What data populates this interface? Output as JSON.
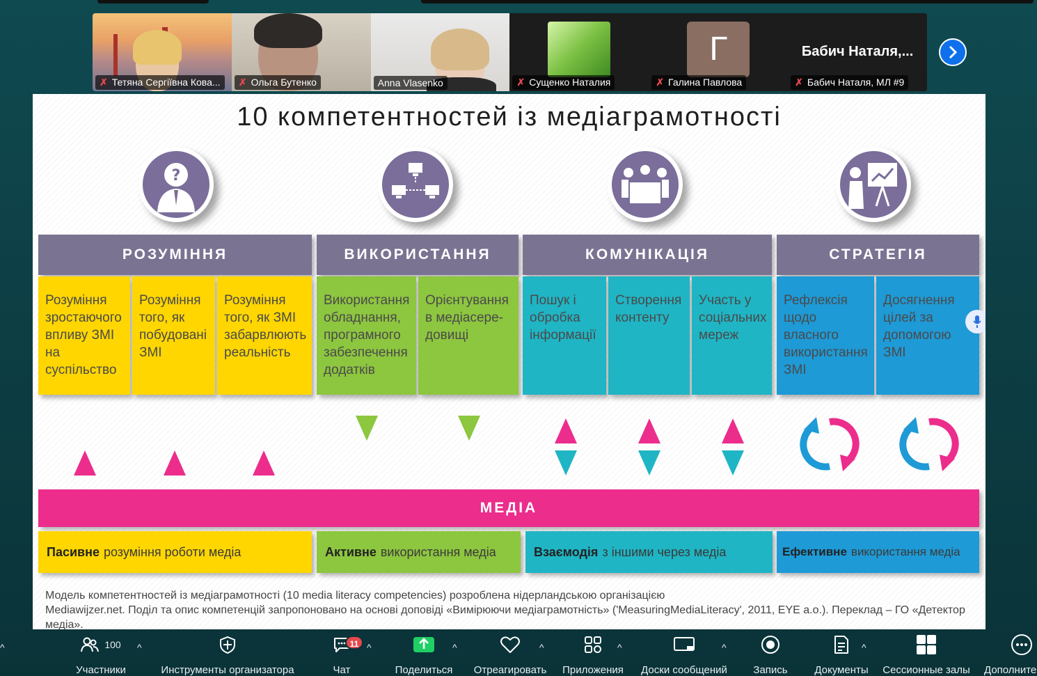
{
  "participants": [
    {
      "name": "Тетяна Сергіївна Кова...",
      "muted": true
    },
    {
      "name": "Ольга Бутенко",
      "muted": true
    },
    {
      "name": "Anna Vlasenko",
      "muted": false,
      "active": true
    },
    {
      "name": "Сущенко Наталия",
      "muted": true
    },
    {
      "name": "Галина Павлова",
      "muted": true,
      "initial": "Г"
    },
    {
      "name": "Бабич Наталя, МЛ #9",
      "muted": true,
      "big_name": "Бабич  Наталя,..."
    }
  ],
  "slide": {
    "title": "10 компетентностей із медіаграмотності",
    "categories": [
      {
        "label": "РОЗУМІННЯ",
        "icon": "question-person-icon"
      },
      {
        "label": "ВИКОРИСТАННЯ",
        "icon": "network-computers-icon"
      },
      {
        "label": "КОМУНІКАЦІЯ",
        "icon": "meeting-table-icon"
      },
      {
        "label": "СТРАТЕГІЯ",
        "icon": "presentation-board-icon"
      }
    ],
    "competences": [
      "Розуміння зростаючого впливу ЗМІ на суспільство",
      "Розуміння того, як побудовані ЗМІ",
      "Розуміння того, як ЗМІ забарвлюють реальність",
      "Використання обладнання, програмного забезпечення додатків",
      "Орієнтування в медіасере-довищі",
      "Пошук і обробка інформації",
      "Створення контенту",
      "Участь у соціальних мереж",
      "Рефлексія щодо власного використання ЗМІ",
      "Досягнення цілей за допомогою ЗМІ"
    ],
    "media_label": "МЕДІА",
    "bottom": [
      {
        "bold": "Пасивне",
        "rest": "розуміння роботи медіа"
      },
      {
        "bold": "Активне",
        "rest": "використання медіа"
      },
      {
        "bold": "Взаємодія",
        "rest": "з іншими через медіа"
      },
      {
        "bold": "Ефективне",
        "rest": "використання медіа"
      }
    ],
    "footnote_line1": "Модель компетентностей із медіаграмотності (10 media  literacy competencies) розроблена  нідерландською  організацією",
    "footnote_line2": "Mediawijzer.net. Поділ та опис компетенцій запропоновано на основі доповіді «Вимірюючи медіаграмотність» ('MeasuringMediaLiteracy', 2011, EYE a.o.). Переклад – ГО «Детектор медіа»."
  },
  "toolbar": {
    "participants_label": "Участники",
    "participants_count": "100",
    "host_tools_label": "Инструменты организатора",
    "chat_label": "Чат",
    "chat_badge": "11",
    "share_label": "Поделиться",
    "react_label": "Отреагировать",
    "apps_label": "Приложения",
    "whiteboards_label": "Доски сообщений",
    "record_label": "Запись",
    "docs_label": "Документы",
    "breakout_label": "Сессионные залы",
    "more_label": "Дополните"
  },
  "colors": {
    "understanding": "#ffd600",
    "use": "#8dc63f",
    "communication": "#1fb5c4",
    "strategy": "#1e9ad6",
    "media": "#ec2d8c",
    "header": "#7a7392",
    "active_speaker": "#2ed67a"
  }
}
